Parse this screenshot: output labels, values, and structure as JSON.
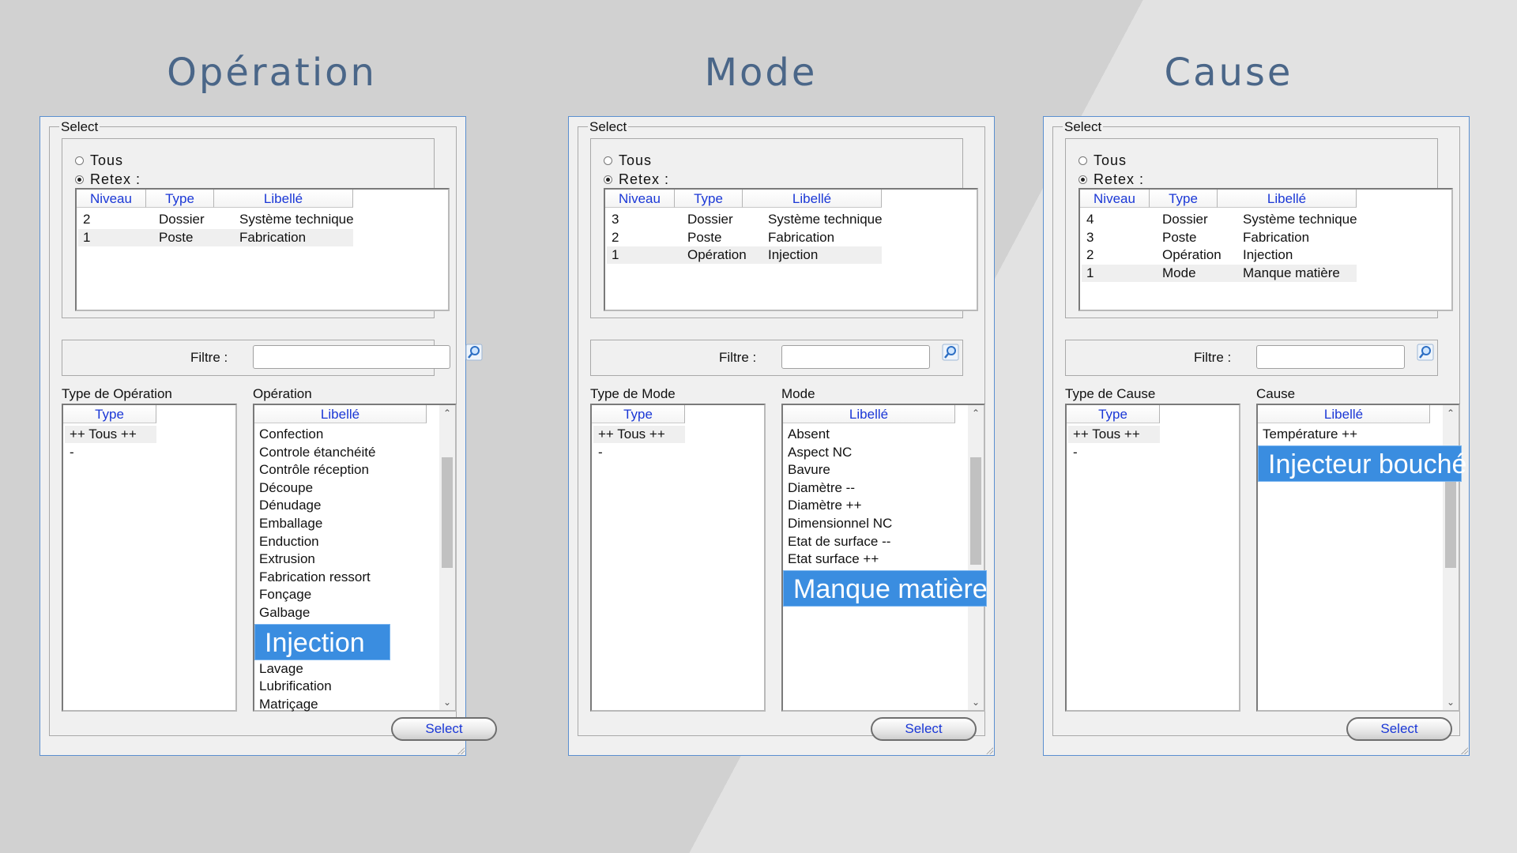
{
  "panels": [
    {
      "title": "Opération",
      "group_label": "Select",
      "radio_all": "Tous",
      "radio_retex": "Retex :",
      "columns": [
        "Niveau",
        "Type",
        "Libellé"
      ],
      "rows": [
        {
          "niveau": "2",
          "type": "Dossier",
          "libelle": "Système technique"
        },
        {
          "niveau": "1",
          "type": "Poste",
          "libelle": "Fabrication"
        }
      ],
      "filter_label": "Filtre :",
      "filter_value": "",
      "type_section_label": "Type de Opération",
      "type_column": "Type",
      "type_items": [
        "++ Tous ++",
        "-"
      ],
      "list_section_label": "Opération",
      "list_column": "Libellé",
      "list_items": [
        "Confection",
        "Controle étanchéité",
        "Contrôle réception",
        "Découpe",
        "Dénudage",
        "Emballage",
        "Enduction",
        "Extrusion",
        "Fabrication ressort",
        "Fonçage",
        "Galbage",
        "Lavage",
        "Lubrification",
        "Matriçage"
      ],
      "highlight": "Injection",
      "select_button": "Select"
    },
    {
      "title": "Mode",
      "group_label": "Select",
      "radio_all": "Tous",
      "radio_retex": "Retex :",
      "columns": [
        "Niveau",
        "Type",
        "Libellé"
      ],
      "rows": [
        {
          "niveau": "3",
          "type": "Dossier",
          "libelle": "Système technique"
        },
        {
          "niveau": "2",
          "type": "Poste",
          "libelle": "Fabrication"
        },
        {
          "niveau": "1",
          "type": "Opération",
          "libelle": "Injection"
        }
      ],
      "filter_label": "Filtre :",
      "filter_value": "",
      "type_section_label": "Type de Mode",
      "type_column": "Type",
      "type_items": [
        "++ Tous ++",
        "-"
      ],
      "list_section_label": "Mode",
      "list_column": "Libellé",
      "list_items": [
        "Absent",
        "Aspect NC",
        "Bavure",
        "Diamètre --",
        "Diamètre ++",
        "Dimensionnel NC",
        "Etat de surface --",
        "Etat surface ++"
      ],
      "highlight": "Manque matière",
      "select_button": "Select"
    },
    {
      "title": "Cause",
      "group_label": "Select",
      "radio_all": "Tous",
      "radio_retex": "Retex :",
      "columns": [
        "Niveau",
        "Type",
        "Libellé"
      ],
      "rows": [
        {
          "niveau": "4",
          "type": "Dossier",
          "libelle": "Système technique"
        },
        {
          "niveau": "3",
          "type": "Poste",
          "libelle": "Fabrication"
        },
        {
          "niveau": "2",
          "type": "Opération",
          "libelle": "Injection"
        },
        {
          "niveau": "1",
          "type": "Mode",
          "libelle": "Manque matière"
        }
      ],
      "filter_label": "Filtre :",
      "filter_value": "",
      "type_section_label": "Type de Cause",
      "type_column": "Type",
      "type_items": [
        "++ Tous ++",
        "-"
      ],
      "list_section_label": "Cause",
      "list_column": "Libellé",
      "list_items": [
        "Température ++"
      ],
      "highlight": "Injecteur bouché",
      "select_button": "Select"
    }
  ],
  "icons": {
    "search": "search-icon",
    "radio": "radio-icon",
    "scroll_up": "chevron-up-icon",
    "scroll_down": "chevron-down-icon"
  },
  "colors": {
    "title": "#4a6688",
    "header_text": "#1a37d6",
    "highlight": "#3a8de0"
  }
}
